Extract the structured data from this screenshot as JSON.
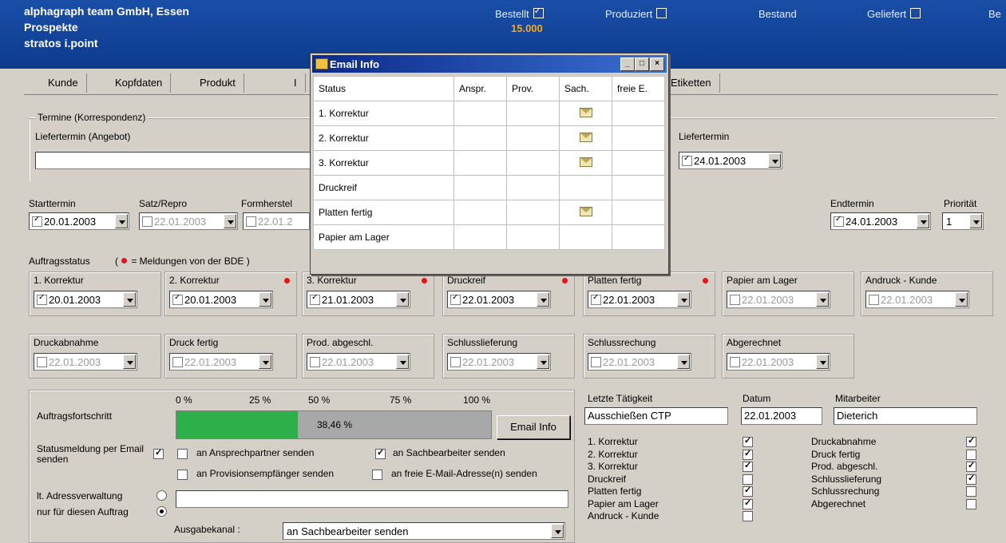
{
  "header": {
    "company": "alphagraph team GmbH, Essen",
    "product": "Prospekte",
    "job": "stratos i.point",
    "status_items": [
      {
        "label": "Bestellt",
        "checked": true
      },
      {
        "label": "Produziert",
        "checked": false
      },
      {
        "label": "Bestand",
        "checked": null
      },
      {
        "label": "Geliefert",
        "checked": false
      },
      {
        "label": "Be",
        "checked": null
      }
    ],
    "quantity": "15.000"
  },
  "tabs": [
    "Kunde",
    "Kopfdaten",
    "Produkt",
    "I",
    "Etiketten"
  ],
  "termine": {
    "group_label": "Termine (Korrespondenz)",
    "liefertermin_angebot_label": "Liefertermin (Angebot)",
    "liefertermin_angebot_value": "",
    "liefertermin_label": "Liefertermin",
    "liefertermin_value": "24.01.2003"
  },
  "planning": {
    "starttermin": {
      "label": "Starttermin",
      "value": "20.01.2003",
      "checked": true
    },
    "satz_repro": {
      "label": "Satz/Repro",
      "value": "22.01.2003",
      "checked": false
    },
    "formherstel": {
      "label": "Formherstel",
      "value": "22.01.2",
      "checked": false
    },
    "endtermin": {
      "label": "Endtermin",
      "value": "24.01.2003",
      "checked": true
    },
    "prioritaet": {
      "label": "Priorität",
      "value": "1"
    }
  },
  "auftragsstatus": {
    "label": "Auftragsstatus",
    "legend_open": "(",
    "legend_text": " = Meldungen von der BDE )",
    "row1": [
      {
        "label": "1. Korrektur",
        "value": "20.01.2003",
        "checked": true,
        "bde": false
      },
      {
        "label": "2. Korrektur",
        "value": "20.01.2003",
        "checked": true,
        "bde": true
      },
      {
        "label": "3. Korrektur",
        "value": "21.01.2003",
        "checked": true,
        "bde": true
      },
      {
        "label": "Druckreif",
        "value": "22.01.2003",
        "checked": true,
        "bde": true
      },
      {
        "label": "Platten fertig",
        "value": "22.01.2003",
        "checked": true,
        "bde": true
      },
      {
        "label": "Papier am Lager",
        "value": "22.01.2003",
        "checked": false,
        "bde": false
      },
      {
        "label": "Andruck - Kunde",
        "value": "22.01.2003",
        "checked": false,
        "bde": false
      }
    ],
    "row2": [
      {
        "label": "Druckabnahme",
        "value": "22.01.2003",
        "checked": false
      },
      {
        "label": "Druck fertig",
        "value": "22.01.2003",
        "checked": false
      },
      {
        "label": "Prod. abgeschl.",
        "value": "22.01.2003",
        "checked": false
      },
      {
        "label": "Schlusslieferung",
        "value": "22.01.2003",
        "checked": false
      },
      {
        "label": "Schlussrechung",
        "value": "22.01.2003",
        "checked": false
      },
      {
        "label": "Abgerechnet",
        "value": "22.01.2003",
        "checked": false
      }
    ]
  },
  "progress": {
    "label": "Auftragsfortschritt",
    "ticks": [
      "0 %",
      "25 %",
      "50 %",
      "75 %",
      "100 %"
    ],
    "value_text": "38,46 %",
    "fill_fraction": 0.3846,
    "email_button": "Email Info"
  },
  "email": {
    "statusmeldung_label": "Statusmeldung per Email senden",
    "statusmeldung_checked": true,
    "options": [
      {
        "label": "an Ansprechpartner senden",
        "checked": false
      },
      {
        "label": "an Sachbearbeiter senden",
        "checked": true
      },
      {
        "label": "an Provisionsempfänger senden",
        "checked": false
      },
      {
        "label": "an freie E-Mail-Adresse(n) senden",
        "checked": false
      }
    ],
    "radio_adress": "lt. Adressverwaltung",
    "radio_auftrag": "nur für diesen Auftrag",
    "adresse_value": "",
    "ausgabekanal_label": "Ausgabekanal :",
    "ausgabekanal_value": "an Sachbearbeiter senden"
  },
  "activity": {
    "letzte_label": "Letzte Tätigkeit",
    "letzte_value": "Ausschießen CTP",
    "datum_label": "Datum",
    "datum_value": "22.01.2003",
    "mitarbeiter_label": "Mitarbeiter",
    "mitarbeiter_value": "Dieterich",
    "left_items": [
      {
        "label": "1. Korrektur",
        "checked": true
      },
      {
        "label": "2. Korrektur",
        "checked": true
      },
      {
        "label": "3. Korrektur",
        "checked": true
      },
      {
        "label": "Druckreif",
        "checked": false
      },
      {
        "label": "Platten fertig",
        "checked": true
      },
      {
        "label": "Papier am Lager",
        "checked": true
      },
      {
        "label": "Andruck - Kunde",
        "checked": false
      }
    ],
    "right_items": [
      {
        "label": "Druckabnahme",
        "checked": true
      },
      {
        "label": "Druck fertig",
        "checked": false
      },
      {
        "label": "Prod. abgeschl.",
        "checked": true
      },
      {
        "label": "Schlusslieferung",
        "checked": true
      },
      {
        "label": "Schlussrechung",
        "checked": false
      },
      {
        "label": "Abgerechnet",
        "checked": false
      }
    ]
  },
  "popup": {
    "title": "Email Info",
    "minimize": "_",
    "maximize": "□",
    "close": "×",
    "columns": [
      "Status",
      "Anspr.",
      "Prov.",
      "Sach.",
      "freie E."
    ],
    "rows": [
      {
        "status": "1. Korrektur",
        "sach": true
      },
      {
        "status": "2. Korrektur",
        "sach": true
      },
      {
        "status": "3. Korrektur",
        "sach": true
      },
      {
        "status": "Druckreif",
        "sach": false
      },
      {
        "status": "Platten fertig",
        "sach": true
      },
      {
        "status": "Papier am Lager",
        "sach": false
      }
    ]
  },
  "colors": {
    "header_bg": "#0c3a8c",
    "accent_orange": "#f7a81b",
    "progress_green": "#2db04a",
    "bde_red": "#e01818"
  }
}
